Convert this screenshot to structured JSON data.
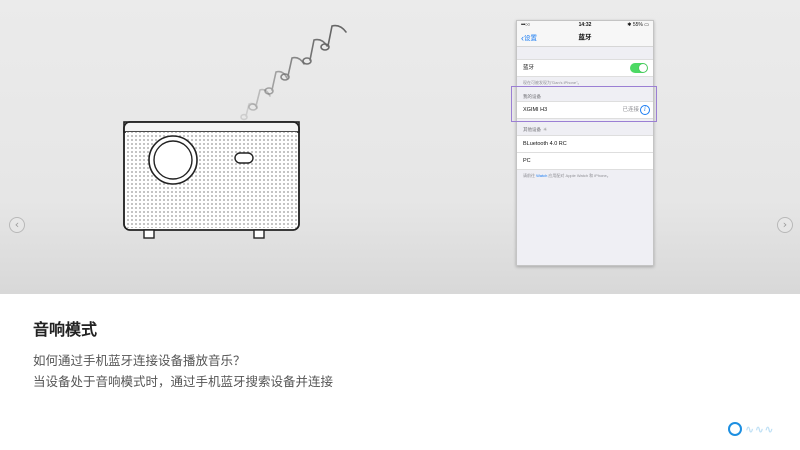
{
  "carousel": {
    "prev_icon": "‹",
    "next_icon": "›"
  },
  "phone": {
    "status_bar": {
      "signal": "•••○○",
      "time": "14:32",
      "battery": "✱ 55% ▭"
    },
    "nav": {
      "back_label": "设置",
      "title": "蓝牙"
    },
    "bluetooth": {
      "label": "蓝牙",
      "enabled": true,
      "discoverable_caption": "现在可被发现为\"Dan's iPhone\"。"
    },
    "my_devices": {
      "header": "我的设备",
      "items": [
        {
          "name": "XGIMI H3",
          "status": "已连接"
        }
      ]
    },
    "other_devices": {
      "header": "其他设备",
      "items": [
        {
          "name": "BLuetooth 4.0 RC"
        },
        {
          "name": "PC"
        }
      ]
    },
    "footer": {
      "prefix": "请前往 ",
      "link": "Watch",
      "suffix": " 应用配对 Apple Watch 和 iPhone。"
    }
  },
  "content": {
    "title": "音响模式",
    "line1": "如何通过手机蓝牙连接设备播放音乐？",
    "line2": "当设备处于音响模式时，通过手机蓝牙搜索设备并连接"
  },
  "colors": {
    "accent_blue": "#1a7cf3",
    "toggle_green": "#4cd964",
    "highlight_purple": "#9b7fd4"
  }
}
